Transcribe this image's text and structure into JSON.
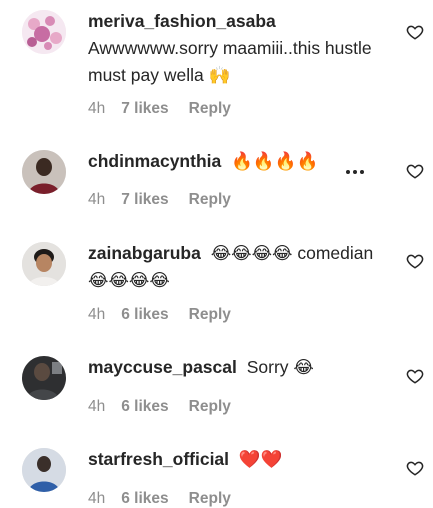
{
  "comments": [
    {
      "username": "meriva_fashion_asaba",
      "text": "Awwwwww.sorry maamiii..this hustle must pay wella 🙌",
      "time": "4h",
      "likes": "7 likes",
      "reply": "Reply",
      "avatar_icon": "flower-avatar"
    },
    {
      "username": "chdinmacynthia",
      "text": "🔥🔥🔥🔥",
      "time": "4h",
      "likes": "7 likes",
      "reply": "Reply",
      "avatar_icon": "person-avatar",
      "has_more_menu": true
    },
    {
      "username": "zainabgaruba",
      "text": "😂😂😂😂 comedian 😂😂😂😂",
      "time": "4h",
      "likes": "6 likes",
      "reply": "Reply",
      "avatar_icon": "person-avatar"
    },
    {
      "username": "mayccuse_pascal",
      "text": "Sorry 😂",
      "time": "4h",
      "likes": "6 likes",
      "reply": "Reply",
      "avatar_icon": "person-avatar"
    },
    {
      "username": "starfresh_official",
      "text": "❤️❤️",
      "time": "4h",
      "likes": "6 likes",
      "reply": "Reply",
      "avatar_icon": "person-avatar"
    }
  ],
  "colors": {
    "text": "#262626",
    "muted": "#8e8e8e",
    "background": "#ffffff"
  }
}
